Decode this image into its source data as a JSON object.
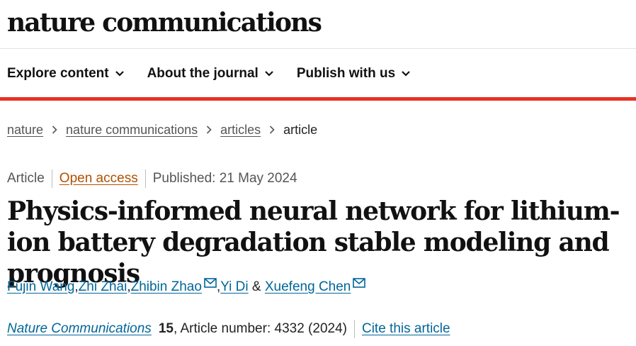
{
  "header": {
    "logo_text": "nature communications"
  },
  "nav": {
    "items": [
      {
        "label": "Explore content"
      },
      {
        "label": "About the journal"
      },
      {
        "label": "Publish with us"
      }
    ]
  },
  "breadcrumb": {
    "items": [
      "nature",
      "nature communications",
      "articles"
    ],
    "current": "article"
  },
  "meta": {
    "type": "Article",
    "access": "Open access",
    "published": "Published: 21 May 2024"
  },
  "article": {
    "title": "Physics-informed neural network for lithium-ion battery degradation stable modeling and prognosis"
  },
  "authors": {
    "list": [
      "Fujin Wang",
      "Zhi Zhai",
      "Zhibin Zhao",
      "Yi Di",
      "Xuefeng Chen"
    ],
    "separator": ", ",
    "conjunction": " & "
  },
  "citation": {
    "journal": "Nature Communications",
    "volume": "15",
    "rest": ", Article number: 4332 (2024)",
    "cite_label": "Cite this article"
  },
  "colors": {
    "accent_bar": "#e63223",
    "link": "#006699",
    "open_access": "#b25000"
  },
  "icons": {
    "nav_dropdown": "chevron-down-icon",
    "breadcrumb_separator": "chevron-right-icon",
    "corresponding_author": "mail-icon"
  }
}
